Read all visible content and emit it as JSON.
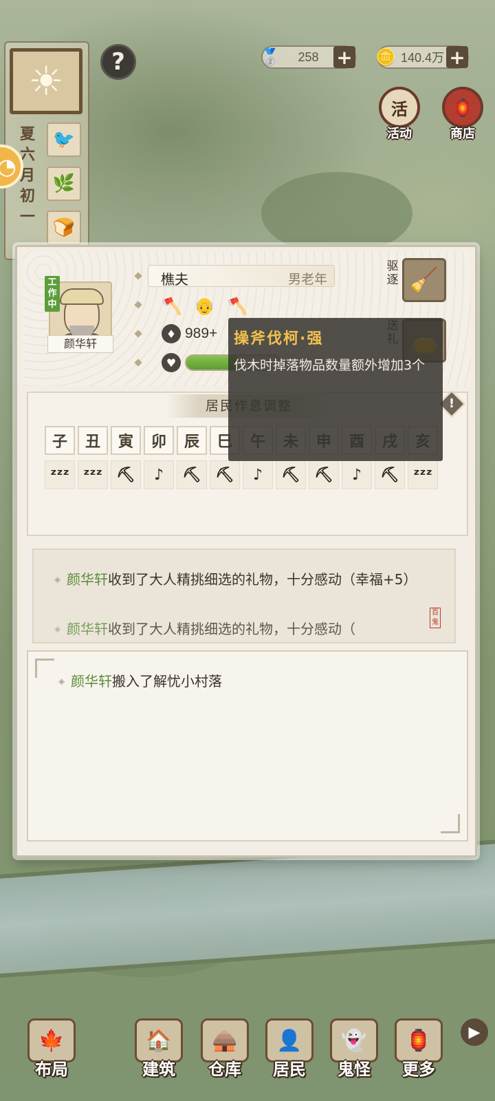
{
  "hud": {
    "silver": "258",
    "coins": "140.4万",
    "plus": "+",
    "help": "?",
    "calendar": [
      "夏",
      "六",
      "月",
      "初",
      "一"
    ],
    "activity_label": "活动",
    "activity_icon_text": "活",
    "shop_label": "商店"
  },
  "resident": {
    "status_badge": "工作中",
    "name": "颜华轩",
    "job": "樵夫",
    "meta": "男老年",
    "stat_value": "989+",
    "happiness_fraction": 0.55,
    "expel_label": "驱逐",
    "gift_label": "送礼"
  },
  "schedule": {
    "title": "居民作息调整",
    "hours": [
      "子",
      "丑",
      "寅",
      "卯",
      "辰",
      "巳",
      "午",
      "未",
      "申",
      "酉",
      "戌",
      "亥"
    ],
    "activities": [
      "sleep",
      "sleep",
      "chop",
      "rest",
      "chop",
      "chop",
      "rest",
      "chop",
      "chop",
      "rest",
      "chop",
      "sleep"
    ]
  },
  "icons": {
    "sleep": "ᶻᶻᶻ",
    "chop": "⛏",
    "rest": "♪"
  },
  "logs": {
    "gift_name": "颜华轩",
    "gift_text": "收到了大人精挑细选的礼物，十分感动（幸福+5）",
    "gift_name_2": "颜华轩",
    "gift_text_2": "收到了大人精挑细选的礼物，十分感动（",
    "stamp": "百鬼",
    "move_name": "颜华轩",
    "move_text": "搬入了解忧小村落"
  },
  "tooltip": {
    "title": "操斧伐柯·强",
    "desc": "伐木时掉落物品数量额外增加3个"
  },
  "nav": {
    "items": [
      "布局",
      "建筑",
      "仓库",
      "居民",
      "鬼怪",
      "更多"
    ],
    "more_arrow": "▶"
  }
}
